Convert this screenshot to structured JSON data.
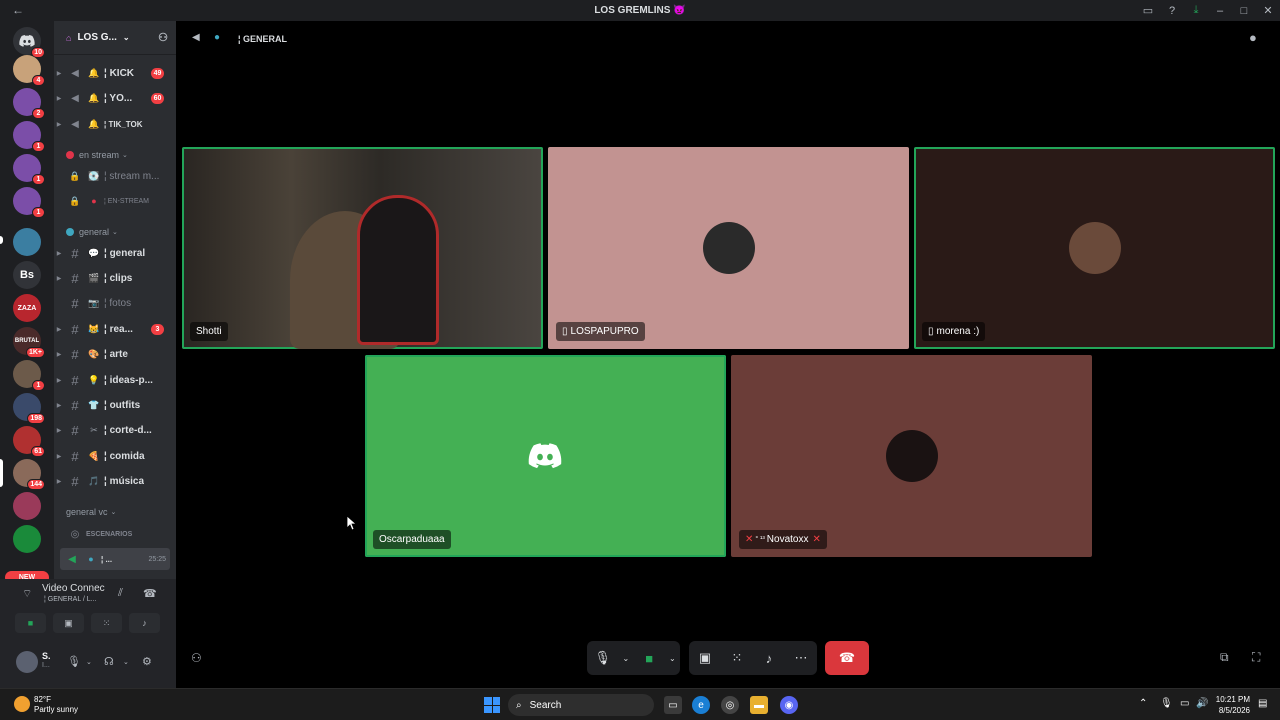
{
  "window": {
    "title": "LOS GREMLINS 👿",
    "back_glyph": "←"
  },
  "server_rail": {
    "home_badge": "10",
    "servers": [
      {
        "name": "server-1",
        "badge": "4",
        "color": "#c8a27a"
      },
      {
        "name": "server-2",
        "badge": "2",
        "color": "#7b4ea8"
      },
      {
        "name": "server-3",
        "badge": "1",
        "color": "#7b4ea8"
      },
      {
        "name": "server-4",
        "badge": "1",
        "color": "#7b4ea8"
      },
      {
        "name": "server-5",
        "badge": "1",
        "color": "#7b4ea8"
      },
      {
        "name": "server-6",
        "badge": "",
        "color": "#3b7ea1"
      },
      {
        "name": "server-bs",
        "label": "Bs",
        "badge": "",
        "color": "#313338"
      },
      {
        "name": "server-zaza",
        "label": "ZAZA",
        "badge": "",
        "color": "#b8262e"
      },
      {
        "name": "server-brutal",
        "label": "BRUTAL",
        "badge": "1K+",
        "color": "#4a2a2a"
      },
      {
        "name": "server-10",
        "badge": "1",
        "color": "#6c5a4a"
      },
      {
        "name": "server-11",
        "badge": "198",
        "color": "#3a4a6a"
      },
      {
        "name": "server-12",
        "badge": "61",
        "color": "#b03030"
      },
      {
        "name": "server-13",
        "badge": "144",
        "color": "#8a6a5a"
      },
      {
        "name": "server-14",
        "badge": "",
        "color": "#9a3a5a"
      },
      {
        "name": "server-15",
        "badge": "",
        "color": "#1a8a3a"
      }
    ],
    "new_label": "NEW"
  },
  "sidebar": {
    "server_name": "LOS G...",
    "channels_top": [
      {
        "name": "KICK",
        "count": "49"
      },
      {
        "name": "YO...",
        "count": "60"
      },
      {
        "name": "TIK_TOK",
        "count": ""
      }
    ],
    "category_stream": "en stream",
    "stream_channels": [
      {
        "name": "stream m..."
      },
      {
        "name": "EN-STREAM"
      }
    ],
    "category_general": "general",
    "text_channels": [
      {
        "name": "general",
        "emoji": "💬",
        "count": "",
        "muted": false
      },
      {
        "name": "clips",
        "emoji": "🎬",
        "count": "",
        "muted": false
      },
      {
        "name": "fotos",
        "emoji": "📷",
        "count": "",
        "muted": true
      },
      {
        "name": "rea...",
        "emoji": "😹",
        "count": "3",
        "muted": false
      },
      {
        "name": "arte",
        "emoji": "🎨",
        "count": "",
        "muted": false
      },
      {
        "name": "ideas-p...",
        "emoji": "💡",
        "count": "",
        "muted": false
      },
      {
        "name": "outfits",
        "emoji": "👕",
        "count": "",
        "muted": false
      },
      {
        "name": "corte-d...",
        "emoji": "✂",
        "count": "",
        "muted": false
      },
      {
        "name": "comida",
        "emoji": "🍕",
        "count": "",
        "muted": false
      },
      {
        "name": "música",
        "emoji": "🎵",
        "count": "",
        "muted": false
      }
    ],
    "category_vc": "general vc",
    "vc_channels": [
      {
        "name": "ESCENARIOS"
      },
      {
        "name": "¦ ...",
        "time": "25:25"
      }
    ]
  },
  "voice_panel": {
    "status": "Video Connec",
    "channel": "¦ GENERAL / L..."
  },
  "user": {
    "name": "S.",
    "status": "I..."
  },
  "main": {
    "channel_title": "¦ GENERAL",
    "tiles": [
      {
        "name": "Shotti",
        "bg": "#3a3530"
      },
      {
        "name": "LOSPAPUPRO",
        "bg": "#c29391"
      },
      {
        "name": "morena :)",
        "bg": "#2a1a17"
      },
      {
        "name": "Oscarpaduaaa",
        "bg": "#44b054"
      },
      {
        "name": "Novatoxx",
        "bg": "#6b3d38"
      }
    ]
  },
  "taskbar": {
    "temp": "82°F",
    "weather": "Partly sunny",
    "search": "Search",
    "time": "10:21 PM",
    "date": "8/5/2026"
  }
}
